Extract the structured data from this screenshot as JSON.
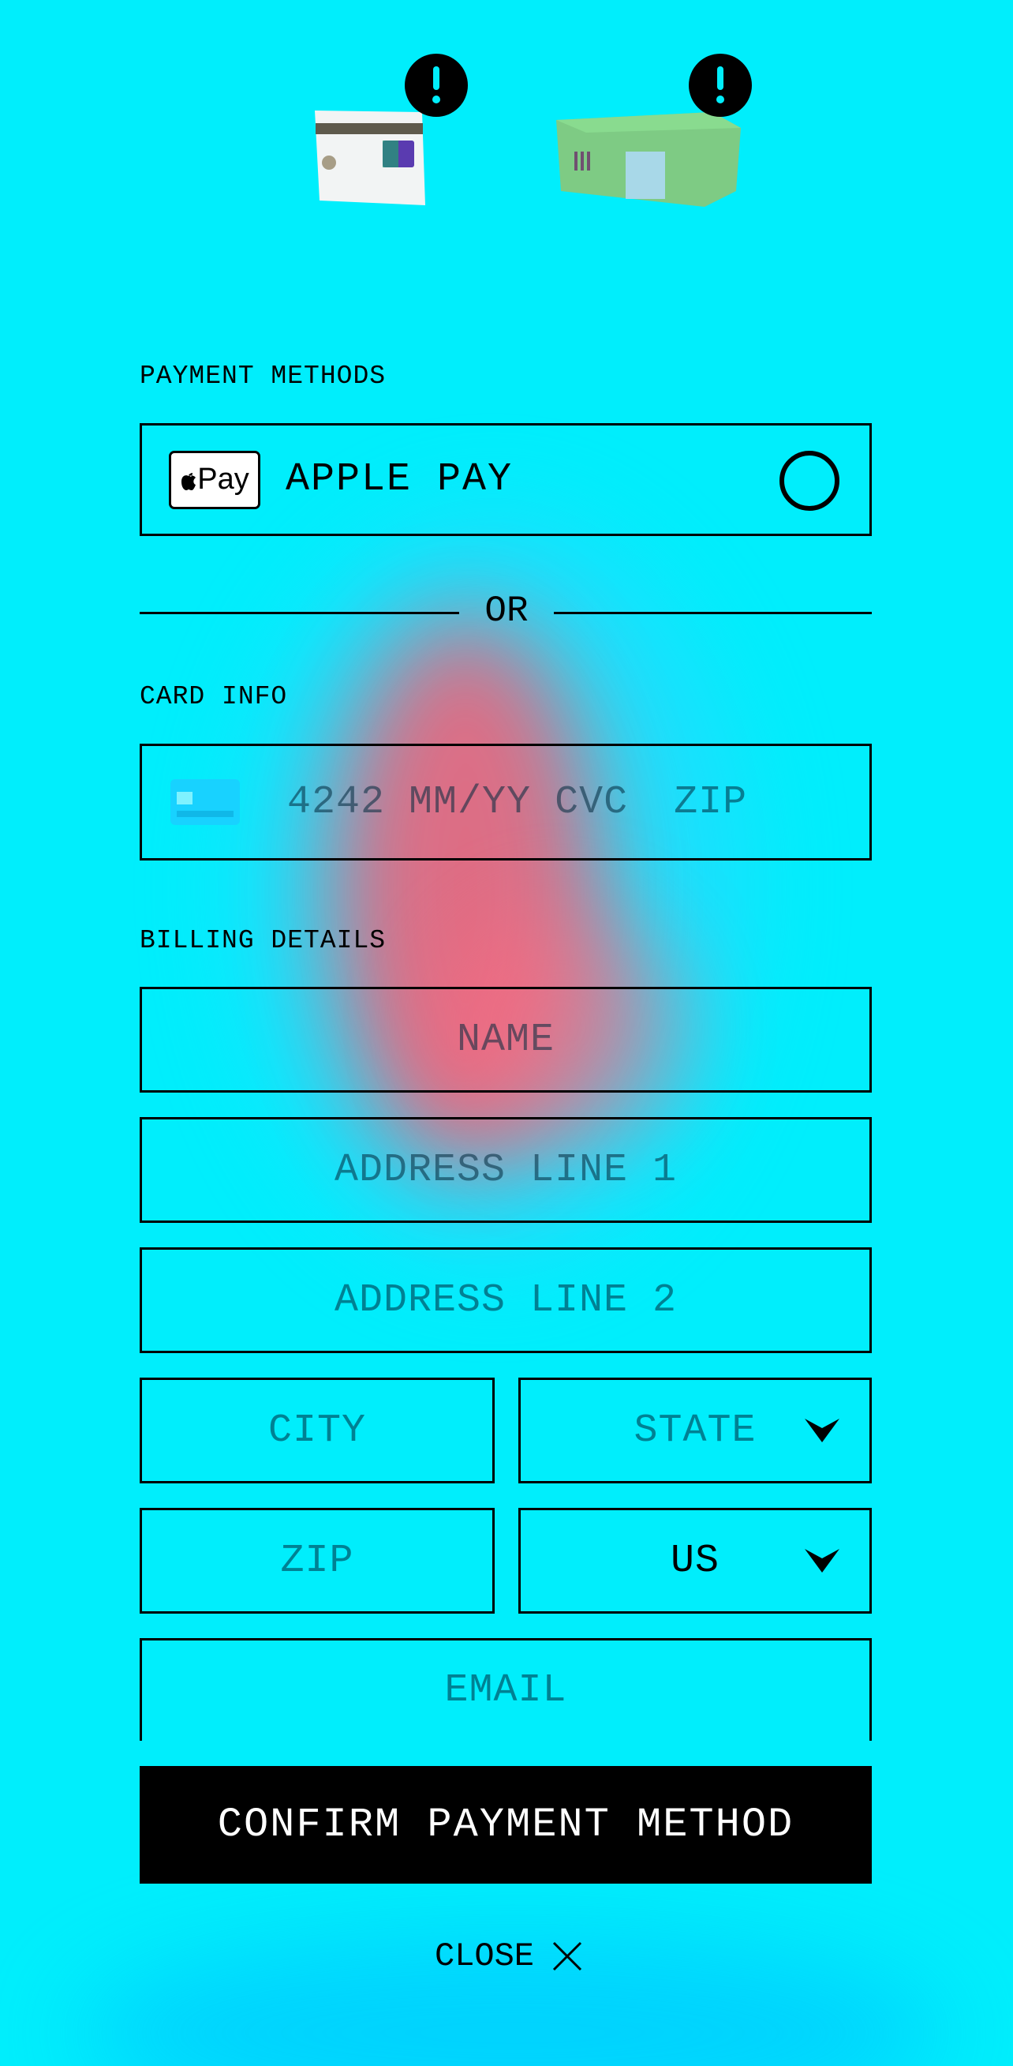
{
  "header": {
    "items": [
      {
        "name": "card",
        "icon": "credit-card-image",
        "badge": "exclamation-icon"
      },
      {
        "name": "shipping-box",
        "icon": "package-image",
        "badge": "exclamation-icon"
      }
    ]
  },
  "payment_methods": {
    "label": "PAYMENT METHODS",
    "apple_pay": {
      "logo_text": "Pay",
      "label": "APPLE PAY",
      "selected": false
    }
  },
  "divider": {
    "text": "OR"
  },
  "card_info": {
    "label": "CARD INFO",
    "number_placeholder": "4242",
    "expiry_placeholder": "MM/YY",
    "cvc_placeholder": "CVC",
    "zip_placeholder": "ZIP"
  },
  "billing": {
    "label": "BILLING DETAILS",
    "name": "NAME",
    "address1": "ADDRESS LINE 1",
    "address2": "ADDRESS LINE 2",
    "city": "CITY",
    "state": "STATE",
    "zip": "ZIP",
    "country": "US",
    "email": "EMAIL"
  },
  "actions": {
    "confirm": "CONFIRM PAYMENT METHOD",
    "close": "CLOSE"
  },
  "colors": {
    "background": "#00eefc",
    "accent": "#000000",
    "blob": "#ff5a6e"
  }
}
